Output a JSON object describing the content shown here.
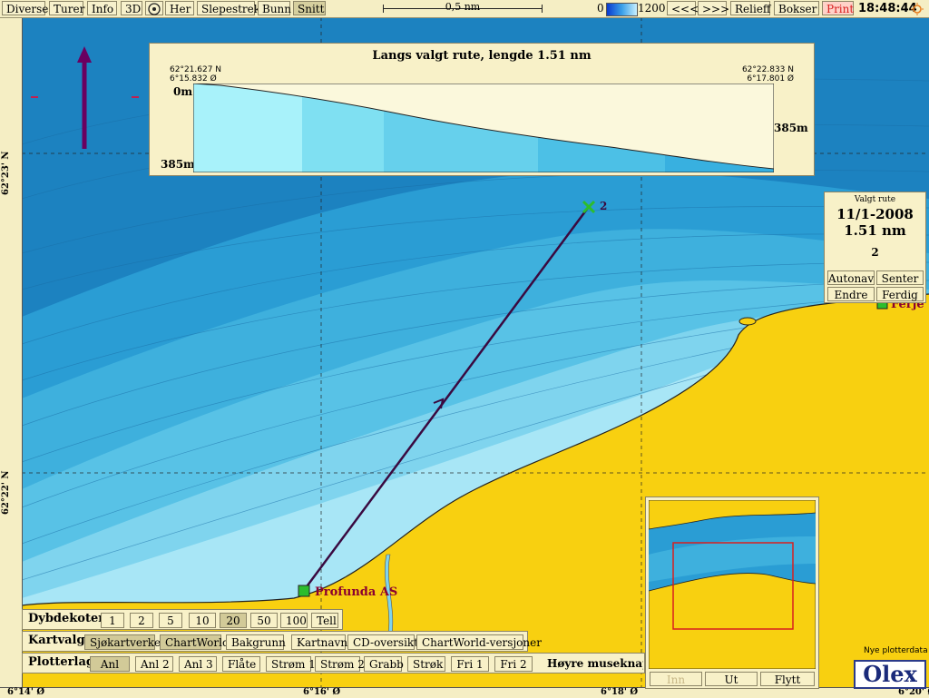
{
  "toolbar": {
    "menu": [
      "Diverse",
      "Turer",
      "Info",
      "3D"
    ],
    "her": "Her",
    "slepestrek": "Slepestrek",
    "bunn": "Bunn",
    "snitt": "Snitt",
    "scale_label": "0,5 nm",
    "depth_min": "0",
    "depth_max": "1200",
    "prev": "<<<",
    "next": ">>>",
    "relieff": "Relieff",
    "bokser": "Bokser",
    "print": "Print",
    "time": "18:48:44"
  },
  "profile": {
    "title": "Langs valgt rute, lengde 1.51 nm",
    "start_lat": "62°21.627 N",
    "start_lon": "6°15.832 Ø",
    "end_lat": "62°22.833 N",
    "end_lon": "6°17.801 Ø",
    "depth_top": "0m",
    "depth_bottom": "385m",
    "depth_right": "385m"
  },
  "route_panel": {
    "heading": "Valgt rute",
    "date": "11/1-2008",
    "length": "1.51 nm",
    "waypoint": "2",
    "buttons": [
      "Autonav",
      "Senter",
      "Endre",
      "Ferdig"
    ]
  },
  "map": {
    "waypoint_label": "2",
    "place_label": "Profunda AS",
    "ferje_label": "Ferje"
  },
  "scales": {
    "lat": [
      "62°23' N",
      "62°22' N"
    ],
    "lon": [
      "6°14' Ø",
      "6°16' Ø",
      "6°18' Ø",
      "6°20' Ø"
    ]
  },
  "dybdekoter": {
    "label": "Dybdekoter",
    "values": [
      "1",
      "2",
      "5",
      "10",
      "20",
      "50",
      "100",
      "Tell"
    ],
    "active": "20"
  },
  "kartvalg": {
    "label": "Kartvalg",
    "options": [
      "Sjøkartverket",
      "ChartWorld",
      "Bakgrunn",
      "Kartnavn",
      "CD-oversikt",
      "ChartWorld-versjoner"
    ]
  },
  "plotterlag": {
    "label": "Plotterlag",
    "options": [
      "Anl",
      "Anl 2",
      "Anl 3",
      "Flåte",
      "Strøm 1",
      "Strøm 2",
      "Grabb",
      "Strøk",
      "Fri 1",
      "Fri 2"
    ],
    "hint": "Høyre museknapp"
  },
  "minimap": {
    "buttons": [
      "Inn",
      "Ut",
      "Flytt"
    ]
  },
  "footer": {
    "nye_plotterdata": "Nye plotterdata",
    "logo": "Olex"
  }
}
